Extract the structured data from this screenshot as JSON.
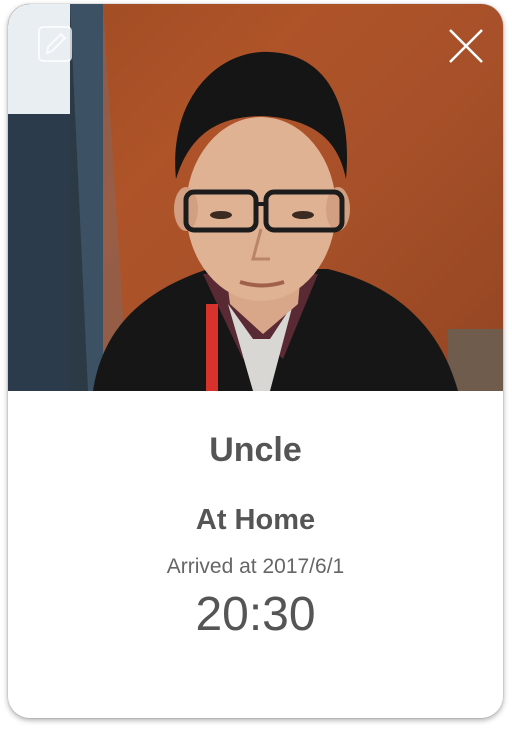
{
  "contact": {
    "name": "Uncle",
    "location": "At Home",
    "arrived_label": "Arrived at 2017/6/1",
    "time": "20:30"
  },
  "icons": {
    "edit": "pencil-edit-icon",
    "close": "close-x-icon"
  },
  "colors": {
    "text": "#555555",
    "card_background": "#ffffff",
    "wall": "#a9512a"
  }
}
